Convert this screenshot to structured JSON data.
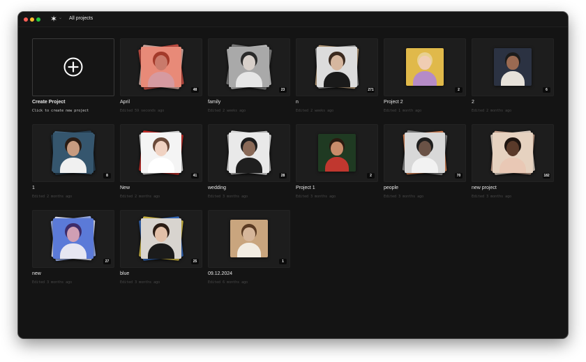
{
  "window": {
    "title": "All projects",
    "logo_icon": "✶",
    "logo_menu_icon": "⌄"
  },
  "create": {
    "name": "Create Project",
    "subtitle": "Click to create new project",
    "icon": "plus-circle-icon"
  },
  "projects": [
    {
      "name": "April",
      "edited": "Edited 59 seconds ago",
      "count": "48",
      "photo": {
        "bg": "#e88a78",
        "skin": "#c97a6b",
        "hair": "#a33a2a",
        "cloth": "#d69aa0",
        "back1": "#c95045",
        "back2": "#e3b9b0"
      }
    },
    {
      "name": "family",
      "edited": "Edited 2 weeks ago",
      "count": "23",
      "photo": {
        "bg": "#a9a9a9",
        "skin": "#d8d0ca",
        "hair": "#2a2a2a",
        "cloth": "#e6e6e6",
        "back1": "#7f7f7f",
        "back2": "#cfcfcf"
      }
    },
    {
      "name": "n",
      "edited": "Edited 2 weeks ago",
      "count": "271",
      "photo": {
        "bg": "#dcdcdc",
        "skin": "#d6b79f",
        "hair": "#3b2a1f",
        "cloth": "#1a1a1a",
        "back1": "#b7b7b7",
        "back2": "#c6a883"
      }
    },
    {
      "name": "Project 2",
      "edited": "Edited 1 month ago",
      "count": "2",
      "photo": {
        "bg": "#e0b94a",
        "skin": "#f0cdb3",
        "hair": "#e8d08f",
        "cloth": "#b58bc7",
        "back1": "#e0b94a",
        "back2": "#e0b94a"
      }
    },
    {
      "name": "2",
      "edited": "Edited 2 months ago",
      "count": "6",
      "photo": {
        "bg": "#2b3242",
        "skin": "#9a6a52",
        "hair": "#1b1b1b",
        "cloth": "#e7e2da",
        "back1": "#2b3242",
        "back2": "#2b3242"
      }
    },
    {
      "name": "1",
      "edited": "Edited 2 months ago",
      "count": "8",
      "photo": {
        "bg": "#35566e",
        "skin": "#c79b80",
        "hair": "#2a1c14",
        "cloth": "#f0f0f0",
        "back1": "#2a4458",
        "back2": "#4c7290"
      }
    },
    {
      "name": "New",
      "edited": "Edited 2 months ago",
      "count": "41",
      "photo": {
        "bg": "#f4f4f4",
        "skin": "#f0d2c2",
        "hair": "#6a4a3a",
        "cloth": "#ffffff",
        "back1": "#d8302c",
        "back2": "#e8e8e8"
      }
    },
    {
      "name": "wedding",
      "edited": "Edited 3 months ago",
      "count": "28",
      "photo": {
        "bg": "#e9e9e9",
        "skin": "#8a6a58",
        "hair": "#1d1d1d",
        "cloth": "#1f1f1f",
        "back1": "#c8c8c8",
        "back2": "#f2f2f2"
      }
    },
    {
      "name": "Project 1",
      "edited": "Edited 3 months ago",
      "count": "2",
      "photo": {
        "bg": "#1f3a22",
        "skin": "#c98c6a",
        "hair": "#2a1a10",
        "cloth": "#c0372f",
        "back1": "#1f3a22",
        "back2": "#1f3a22"
      }
    },
    {
      "name": "people",
      "edited": "Edited 3 months ago",
      "count": "70",
      "photo": {
        "bg": "#d8d8d8",
        "skin": "#6a5246",
        "hair": "#1e1e1e",
        "cloth": "#f2f2f2",
        "back1": "#8a8a8a",
        "back2": "#e48a5a"
      }
    },
    {
      "name": "new project",
      "edited": "Edited 3 months ago",
      "count": "182",
      "photo": {
        "bg": "#e6d2c0",
        "skin": "#5a3a2a",
        "hair": "#1f1510",
        "cloth": "#e9c8b5",
        "back1": "#d8b09a",
        "back2": "#f1e1d3"
      }
    },
    {
      "name": "new",
      "edited": "Edited 3 months ago",
      "count": "27",
      "photo": {
        "bg": "#5b7ad8",
        "skin": "#cf9fb4",
        "hair": "#3e2c6a",
        "cloth": "#e6e6f2",
        "back1": "#9fb4f2",
        "back2": "#e8ecff"
      }
    },
    {
      "name": "blue",
      "edited": "Edited 3 months ago",
      "count": "25",
      "photo": {
        "bg": "#d8d4cf",
        "skin": "#e2c0a8",
        "hair": "#2a1c14",
        "cloth": "#1b1b1b",
        "back1": "#3a72c9",
        "back2": "#e1c84a"
      }
    },
    {
      "name": "09.12.2024",
      "edited": "Edited 6 months ago",
      "count": "1",
      "photo": {
        "bg": "#c9a57e",
        "skin": "#d6b69a",
        "hair": "#5a3a22",
        "cloth": "#f2ece2",
        "back1": "#c9a57e",
        "back2": "#c9a57e"
      }
    }
  ]
}
